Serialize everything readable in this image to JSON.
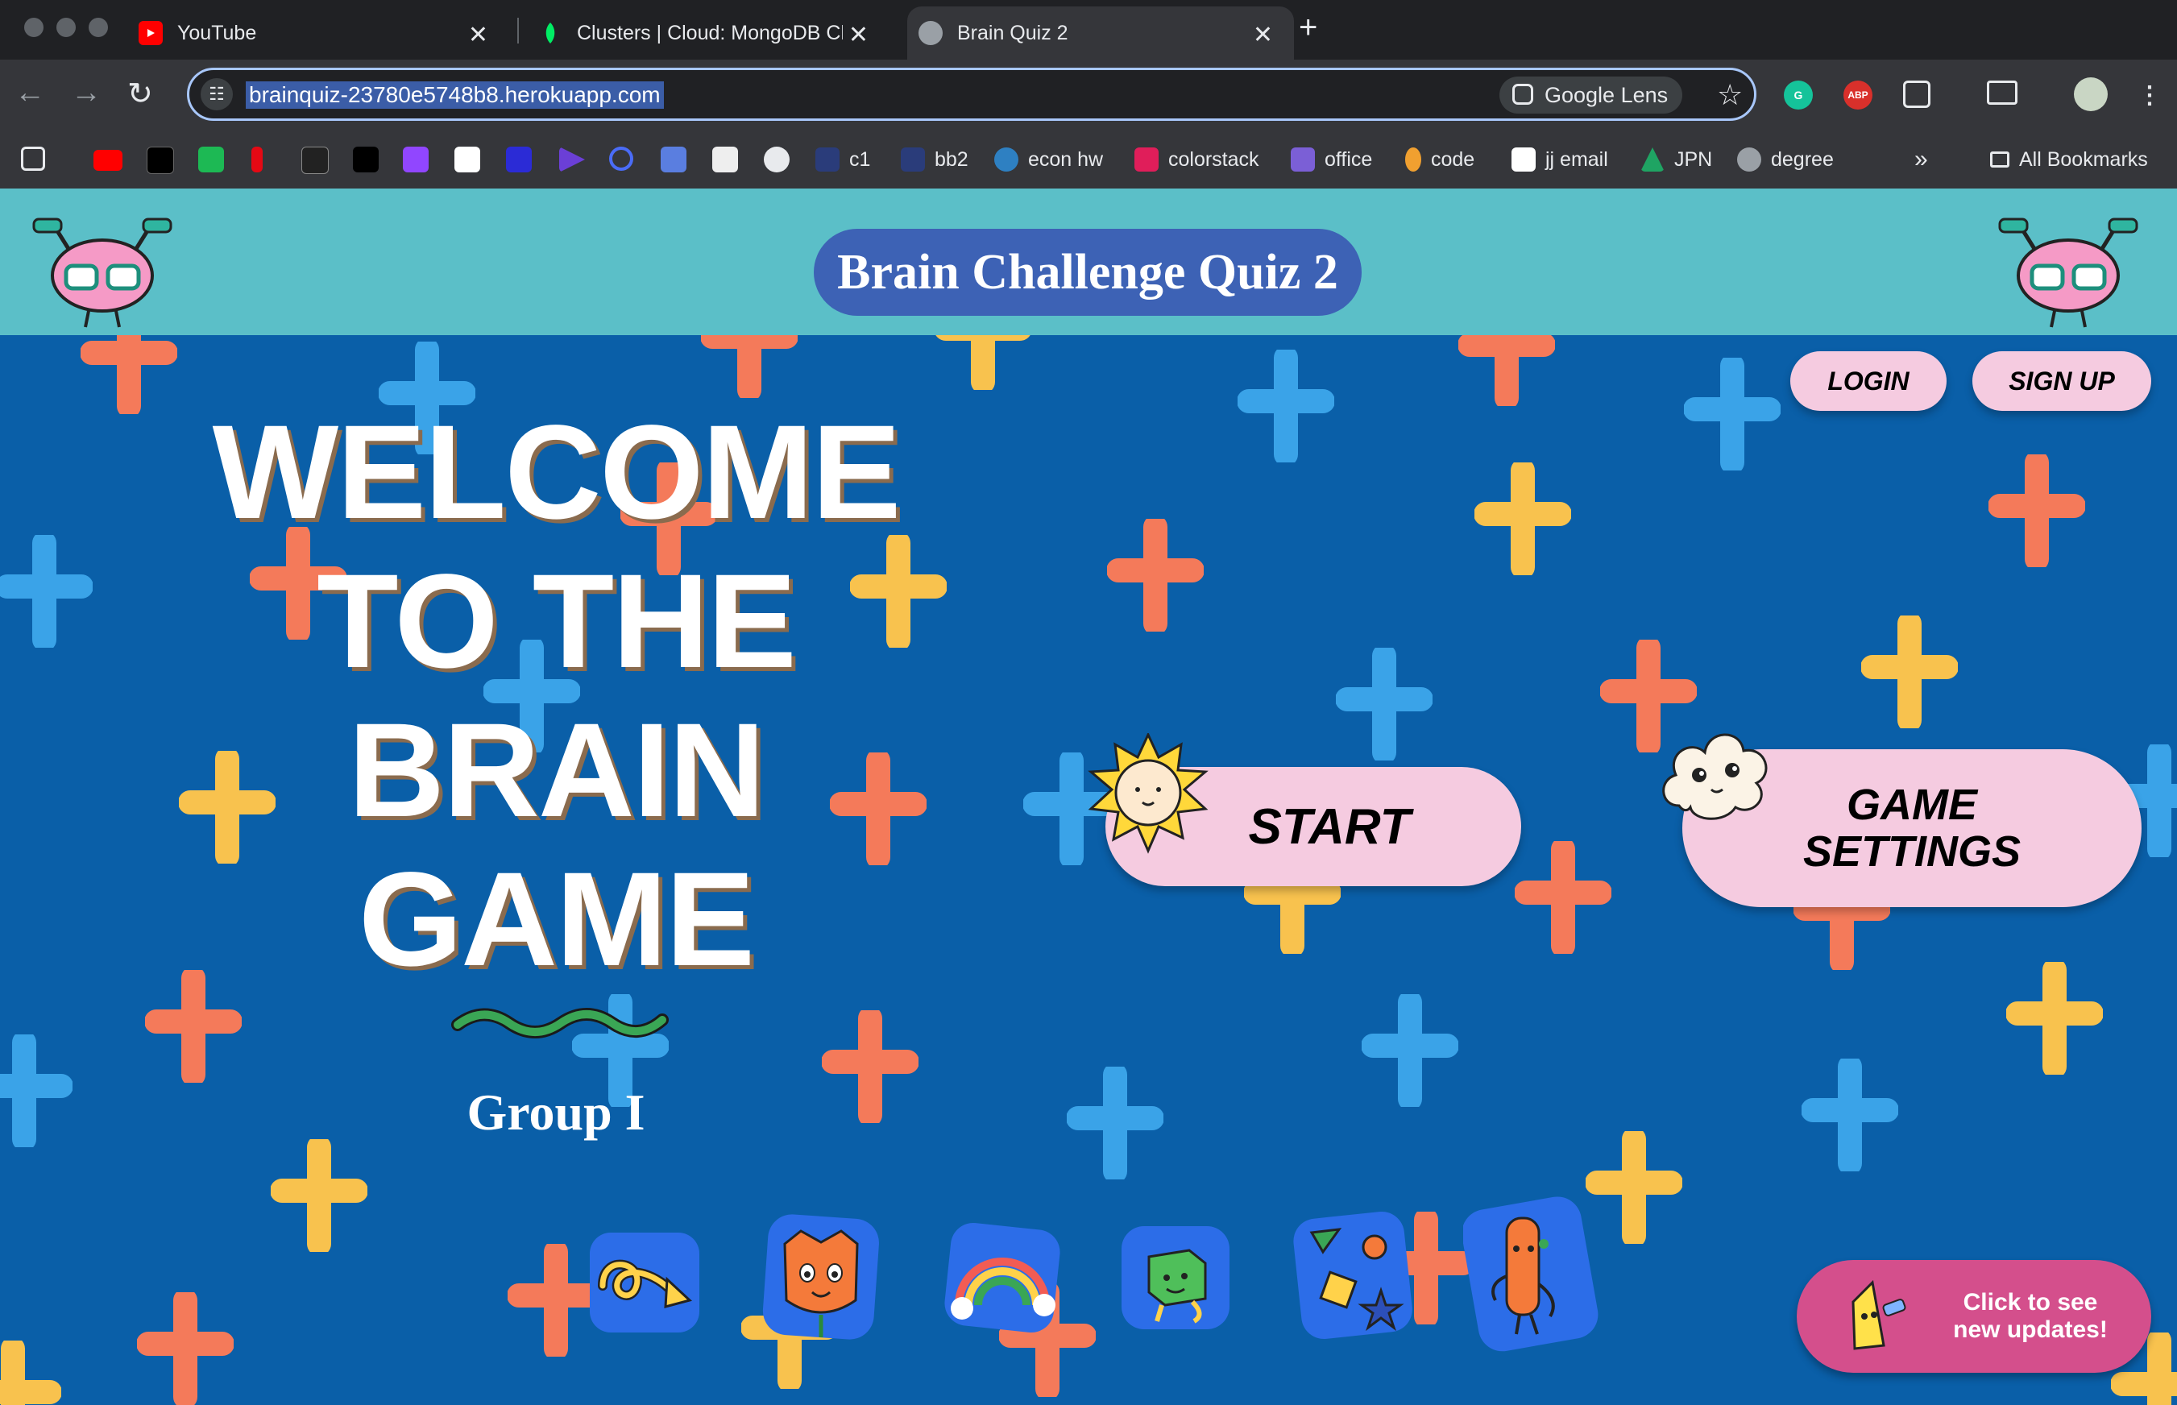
{
  "browser": {
    "tabs": [
      {
        "title": "YouTube",
        "icon": "youtube-icon",
        "color": "#ff0000"
      },
      {
        "title": "Clusters | Cloud: MongoDB Cl",
        "icon": "mongodb-leaf-icon",
        "color": "#00ed64"
      },
      {
        "title": "Brain Quiz 2",
        "icon": "globe-icon",
        "color": "#9aa0a6"
      }
    ],
    "url": "brainquiz-23780e5748b8.herokuapp.com",
    "lens_label": "Google Lens",
    "bookmarks": [
      {
        "label": "c1"
      },
      {
        "label": "bb2"
      },
      {
        "label": "econ hw"
      },
      {
        "label": "colorstack"
      },
      {
        "label": "office"
      },
      {
        "label": "code"
      },
      {
        "label": "jj email"
      },
      {
        "label": "JPN"
      },
      {
        "label": "degree"
      }
    ],
    "all_bookmarks": "All Bookmarks"
  },
  "header": {
    "title": "Brain Challenge Quiz 2"
  },
  "hero": {
    "line1": "WELCOME",
    "line2": "TO THE",
    "line3": "BRAIN",
    "line4": "GAME",
    "group": "Group I"
  },
  "auth": {
    "login": "LOGIN",
    "signup": "SIGN UP"
  },
  "actions": {
    "start": "START",
    "settings_line1": "GAME",
    "settings_line2": "SETTINGS"
  },
  "updates": {
    "line1": "Click to see",
    "line2": "new updates!"
  },
  "colors": {
    "page_bg": "#0a5fa8",
    "header_bg": "#5bbfc8",
    "title_pill": "#3d62b5",
    "button_pink": "#f5cbe0",
    "updates_pink": "#d44f8c",
    "cross_blue": "#3aa3e8",
    "cross_orange": "#f47a5a",
    "cross_yellow": "#f8c24e"
  }
}
